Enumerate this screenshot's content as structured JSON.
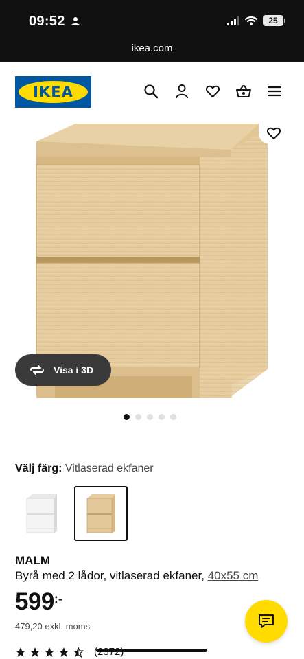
{
  "status_bar": {
    "time": "09:52",
    "battery": "25"
  },
  "browser": {
    "url": "ikea.com"
  },
  "header": {
    "logo_text": "IKEA",
    "icons": [
      "search-icon",
      "profile-icon",
      "heart-icon",
      "basket-icon",
      "menu-icon"
    ]
  },
  "gallery": {
    "view_3d_label": "Visa i 3D",
    "image_count": 5,
    "active_image": 1
  },
  "color": {
    "label": "Välj färg:",
    "value": "Vitlaserad ekfaner",
    "options": [
      "white",
      "oak-veneer"
    ],
    "selected": "oak-veneer"
  },
  "product": {
    "name": "MALM",
    "description": "Byrå med 2 lådor, vitlaserad ekfaner,",
    "measure": "40x55 cm",
    "price_main": "599",
    "price_suffix": ":-",
    "price_ex_vat": "479,20 exkl. moms",
    "rating_stars": 4.5,
    "rating_count": "(2372)"
  },
  "colors": {
    "brand_blue": "#0058a3",
    "brand_yellow": "#ffdb00",
    "wood": "#e3c89a"
  }
}
